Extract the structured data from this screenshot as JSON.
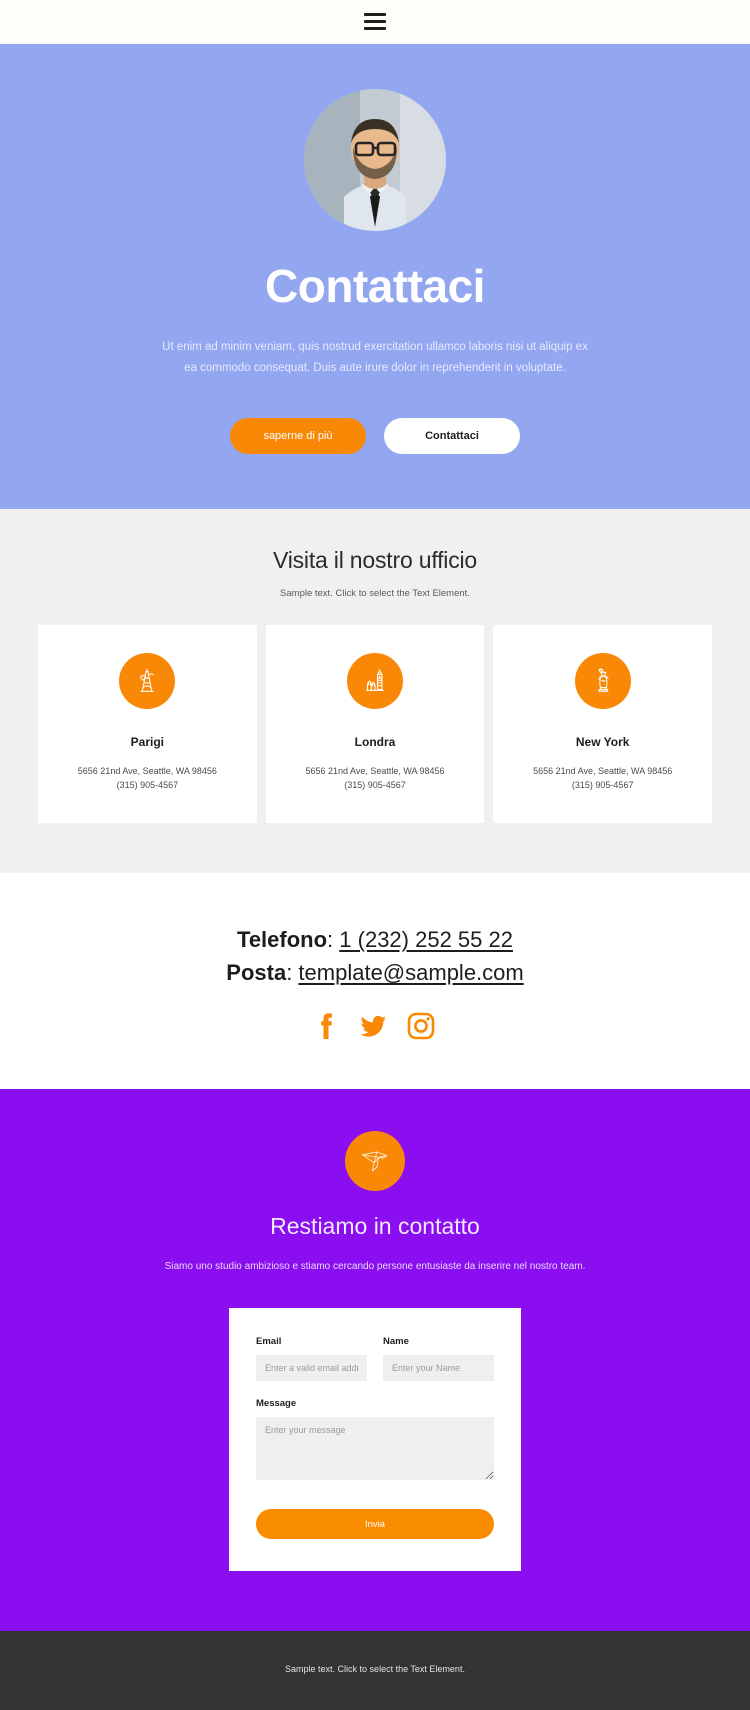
{
  "topbar": {
    "menu_icon": "hamburger-menu-icon"
  },
  "hero": {
    "avatar_alt": "profile-photo",
    "title": "Contattaci",
    "description": "Ut enim ad minim veniam, quis nostrud exercitation ullamco laboris nisi ut aliquip ex ea commodo consequat. Duis aute irure dolor in reprehenderit in voluptate.",
    "primary_button": "saperne di più",
    "secondary_button": "Contattaci",
    "bg_color": "#93A6F0"
  },
  "offices": {
    "heading": "Visita il nostro ufficio",
    "subtitle": "Sample text. Click to select the Text Element.",
    "cards": [
      {
        "icon": "eiffel-tower-icon",
        "name": "Parigi",
        "address": "5656 21nd Ave, Seattle, WA 98456",
        "phone": "(315) 905-4567"
      },
      {
        "icon": "big-ben-icon",
        "name": "Londra",
        "address": "5656 21nd Ave, Seattle, WA 98456",
        "phone": "(315) 905-4567"
      },
      {
        "icon": "statue-of-liberty-icon",
        "name": "New York",
        "address": "5656 21nd Ave, Seattle, WA 98456",
        "phone": "(315) 905-4567"
      }
    ]
  },
  "contact": {
    "phone_label": "Telefono",
    "phone_sep": ": ",
    "phone_value": "1 (232) 252 55 22 ",
    "email_label": "Posta",
    "email_sep": ": ",
    "email_value": "template@sample.com",
    "socials": [
      {
        "name": "facebook-icon"
      },
      {
        "name": "twitter-icon"
      },
      {
        "name": "instagram-icon"
      }
    ]
  },
  "cta": {
    "icon": "origami-bird-icon",
    "heading": "Restiamo in contatto",
    "subtitle": "Siamo uno studio ambizioso e stiamo cercando persone entusiaste da inserire nel nostro team.",
    "bg_color": "#8A0EF0",
    "form": {
      "email_label": "Email",
      "email_placeholder": "Enter a valid email address",
      "email_value": "",
      "name_label": "Name",
      "name_placeholder": "Enter your Name",
      "name_value": "",
      "message_label": "Message",
      "message_placeholder": "Enter your message",
      "message_value": "",
      "submit_label": "Invia"
    }
  },
  "footer": {
    "text": "Sample text. Click to select the Text Element."
  },
  "accent_color": "#F98807"
}
